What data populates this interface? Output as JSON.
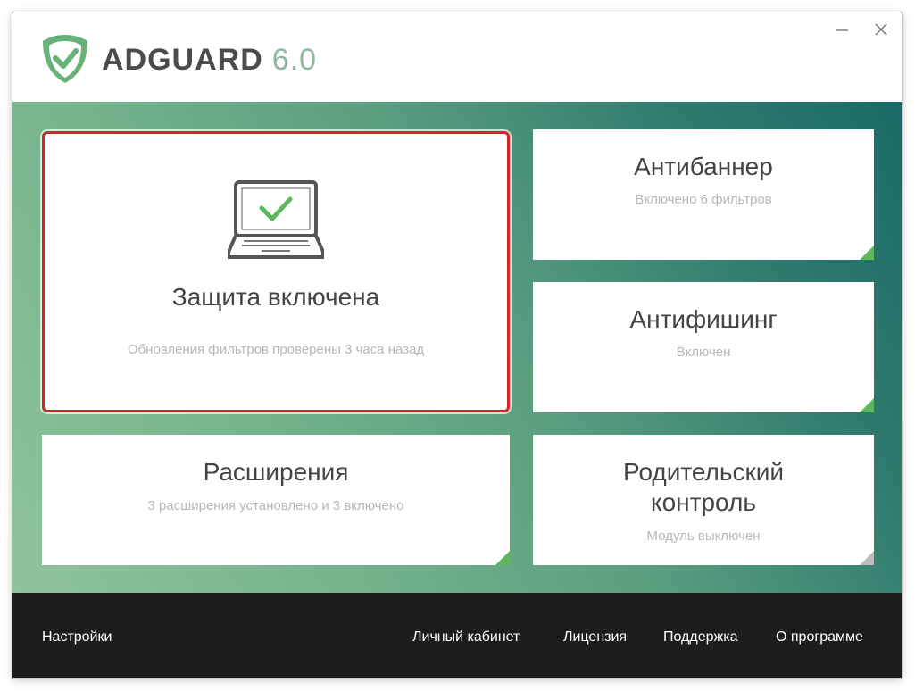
{
  "app": {
    "brand_name": "ADGUARD",
    "version": "6.0",
    "accent_color": "#5cb85c",
    "highlight_color": "#d8232a"
  },
  "window_controls": {
    "minimize_icon": "minimize-icon",
    "close_icon": "close-icon"
  },
  "cards": {
    "protection": {
      "title": "Защита включена",
      "subtitle": "Обновления фильтров проверены 3 часа назад",
      "icon": "laptop-check-icon"
    },
    "antibanner": {
      "title": "Антибаннер",
      "subtitle": "Включено 6 фильтров",
      "status": "enabled"
    },
    "antiphishing": {
      "title": "Антифишинг",
      "subtitle": "Включен",
      "status": "enabled"
    },
    "extensions": {
      "title": "Расширения",
      "subtitle": "3 расширения установлено и 3 включено",
      "status": "enabled"
    },
    "parental": {
      "title_line1": "Родительский",
      "title_line2": "контроль",
      "subtitle": "Модуль выключен",
      "status": "disabled"
    }
  },
  "footer": {
    "settings": "Настройки",
    "account": "Личный кабинет",
    "license": "Лицензия",
    "support": "Поддержка",
    "about": "О программе"
  }
}
